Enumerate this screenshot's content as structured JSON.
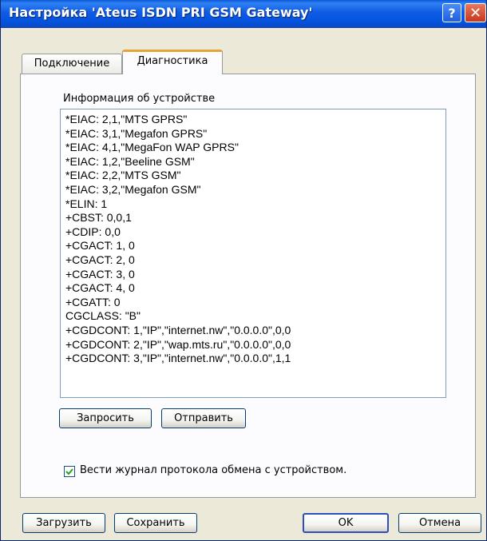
{
  "window": {
    "title": "Настройка 'Ateus ISDN PRI GSM Gateway'",
    "help_glyph": "?",
    "close_glyph": "✕"
  },
  "tabs": [
    {
      "label": "Подключение",
      "active": false
    },
    {
      "label": "Диагностика",
      "active": true
    }
  ],
  "diagnostics": {
    "info_label": "Информация об устройстве",
    "lines": [
      "*EIAC: 2,1,\"MTS GPRS\"",
      "*EIAC: 3,1,\"Megafon GPRS\"",
      "*EIAC: 4,1,\"MegaFon WAP GPRS\"",
      "*EIAC: 1,2,\"Beeline GSM\"",
      "*EIAC: 2,2,\"MTS GSM\"",
      "*EIAC: 3,2,\"Megafon GSM\"",
      "*ELIN: 1",
      "+CBST: 0,0,1",
      "+CDIP: 0,0",
      "+CGACT: 1, 0",
      "+CGACT: 2, 0",
      "+CGACT: 3, 0",
      "+CGACT: 4, 0",
      "+CGATT: 0",
      "CGCLASS: \"B\"",
      "+CGDCONT: 1,\"IP\",\"internet.nw\",\"0.0.0.0\",0,0",
      "+CGDCONT: 2,\"IP\",\"wap.mts.ru\",\"0.0.0.0\",0,0",
      "+CGDCONT: 3,\"IP\",\"internet.nw\",\"0.0.0.0\",1,1"
    ],
    "request_label": "Запросить",
    "send_label": "Отправить",
    "log_checkbox_label": "Вести журнал протокола обмена с устройством.",
    "log_checked": true
  },
  "footer": {
    "load_label": "Загрузить",
    "save_label": "Сохранить",
    "ok_label": "OK",
    "cancel_label": "Отмена"
  }
}
